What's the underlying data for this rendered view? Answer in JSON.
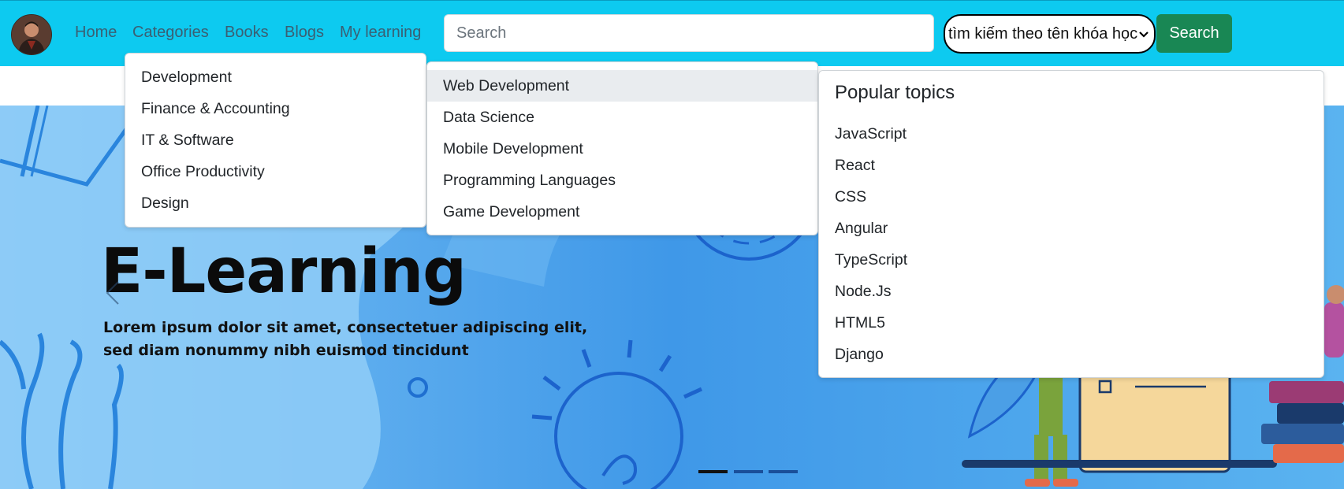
{
  "nav": {
    "links": [
      "Home",
      "Categories",
      "Books",
      "Blogs",
      "My learning"
    ]
  },
  "search": {
    "placeholder": "Search",
    "value": "",
    "select_value": "tìm kiếm theo tên khóa học",
    "button_label": "Search"
  },
  "menus": {
    "categories": [
      "Development",
      "Finance & Accounting",
      "IT & Software",
      "Office Productivity",
      "Design"
    ],
    "subcategories": [
      "Web Development",
      "Data Science",
      "Mobile Development",
      "Programming Languages",
      "Game Development"
    ],
    "topics_header": "Popular topics",
    "topics": [
      "JavaScript",
      "React",
      "CSS",
      "Angular",
      "TypeScript",
      "Node.Js",
      "HTML5",
      "Django"
    ]
  },
  "hero": {
    "title": "E-Learning",
    "text": "Lorem ipsum dolor sit amet, consectetuer adipiscing elit, sed diam nonummy nibh euismod tincidunt",
    "active_slide": 1,
    "slide_count": 3
  },
  "colors": {
    "navbar": "#0dcaf0",
    "search_button": "#198754",
    "hover_item": "#e9ecef",
    "hero_bg": "#4aa6ec"
  }
}
